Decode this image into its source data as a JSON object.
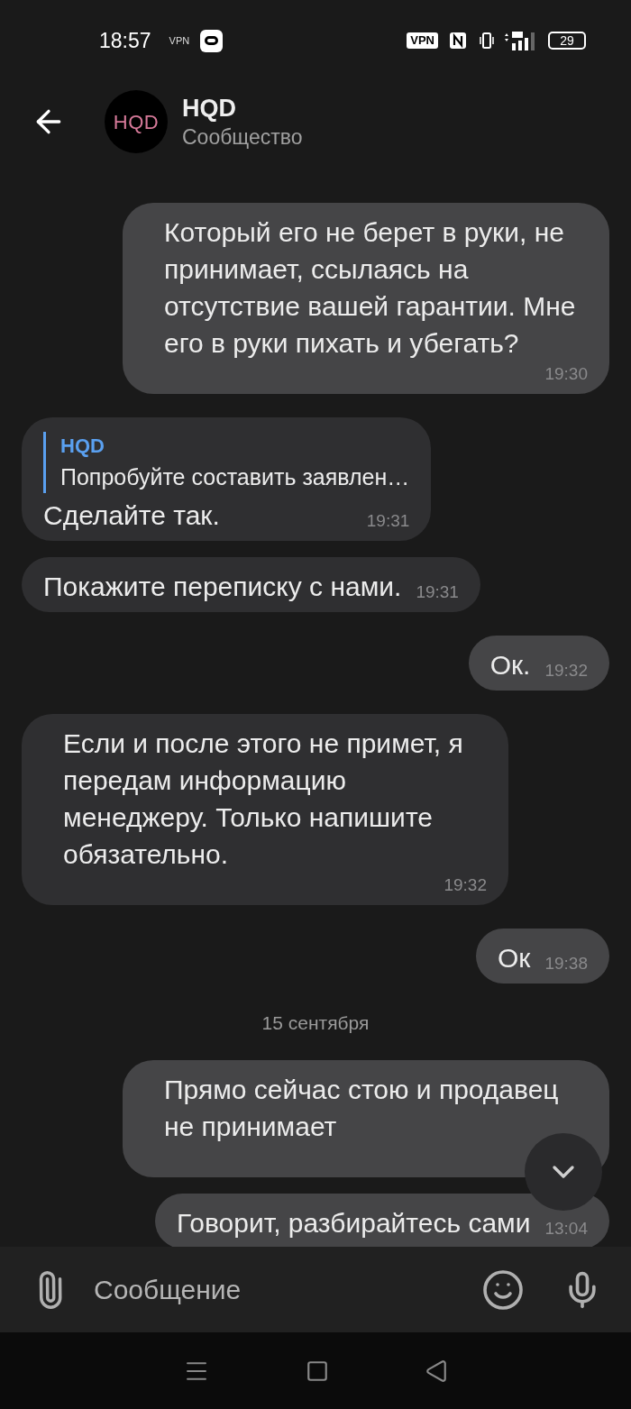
{
  "status_bar": {
    "time": "18:57",
    "vpn_text": "VPN",
    "vpn_badge": "VPN",
    "battery": "29"
  },
  "header": {
    "title": "HQD",
    "subtitle": "Сообщество",
    "avatar_text": "HQD"
  },
  "messages": [
    {
      "kind": "out",
      "text": "Который его не берет в руки, не принимает, ссылаясь на отсутствие вашей гарантии. Мне его в руки пихать и убегать?",
      "time": "19:30"
    },
    {
      "kind": "in",
      "reply": {
        "author": "HQD",
        "text": "Попробуйте составить заявлен…"
      },
      "text": "Сделайте так.",
      "time": "19:31"
    },
    {
      "kind": "in",
      "text": "Покажите переписку с нами.",
      "time": "19:31"
    },
    {
      "kind": "out",
      "text": "Ок.",
      "time": "19:32"
    },
    {
      "kind": "in",
      "text": "Если и после этого не примет, я передам информацию менеджеру. Только напишите обязательно.",
      "time": "19:32"
    },
    {
      "kind": "out",
      "text": "Ок",
      "time": "19:38"
    },
    {
      "kind": "date",
      "text": "15 сентября"
    },
    {
      "kind": "out",
      "text": "Прямо сейчас стою и продавец не принимает"
    },
    {
      "kind": "out",
      "text": "Говорит, разбирайтесь сами",
      "time": "13:04"
    }
  ],
  "composer": {
    "placeholder": "Сообщение"
  }
}
